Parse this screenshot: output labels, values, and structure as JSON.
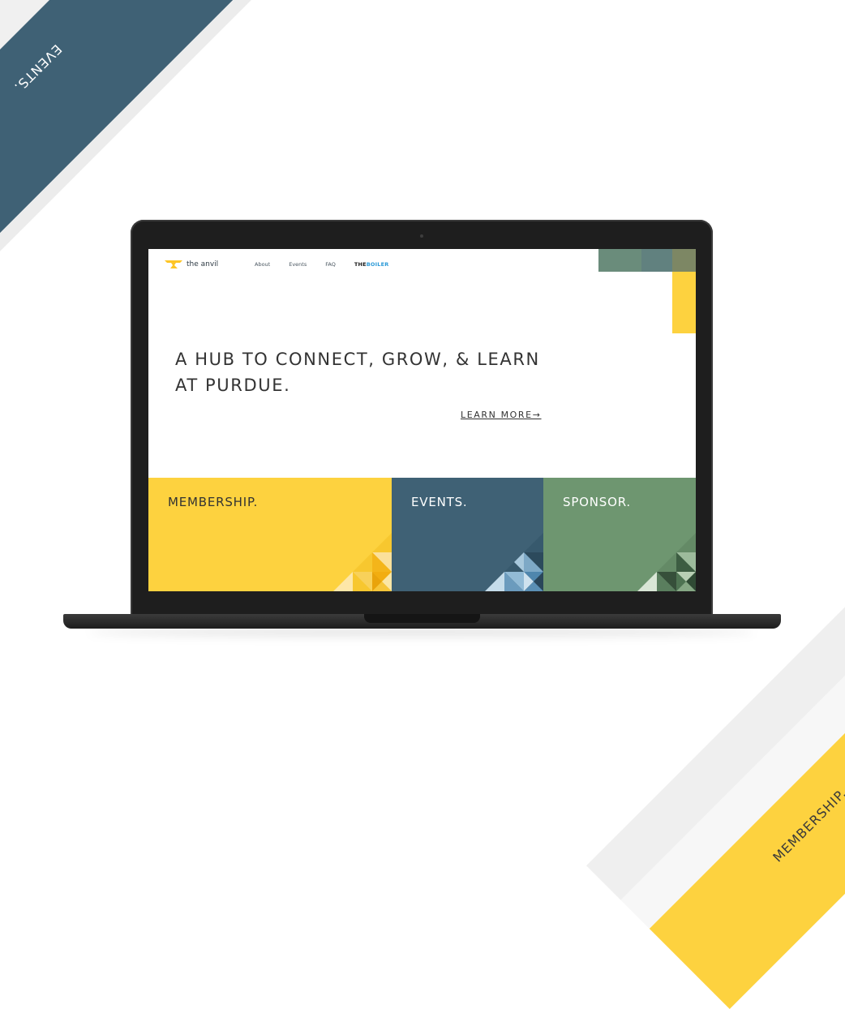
{
  "corner_top_left": {
    "label": "EVENTS.",
    "nav_boiler": "THE BOILER"
  },
  "corner_bottom_right": {
    "label": "MEMBERSHIP.",
    "nav": {
      "events": "Events",
      "faq": "FAQ",
      "boiler_the": "THE",
      "boiler_boiler": "BOILER"
    }
  },
  "site": {
    "logo_text": "the anvil",
    "nav": {
      "about": "About",
      "events": "Events",
      "faq": "FAQ",
      "boiler_the": "THE",
      "boiler_boiler": "BOILER"
    },
    "headline": "A HUB TO CONNECT, GROW, & LEARN AT PURDUE.",
    "learn_more": "LEARN MORE→",
    "tiles": {
      "membership": "MEMBERSHIP.",
      "events": "EVENTS.",
      "sponsor": "SPONSOR."
    }
  },
  "colors": {
    "yellow": "#fdd23f",
    "blue": "#3f6175",
    "green": "#6e9670",
    "boiler_blue": "#2b9ad8"
  }
}
